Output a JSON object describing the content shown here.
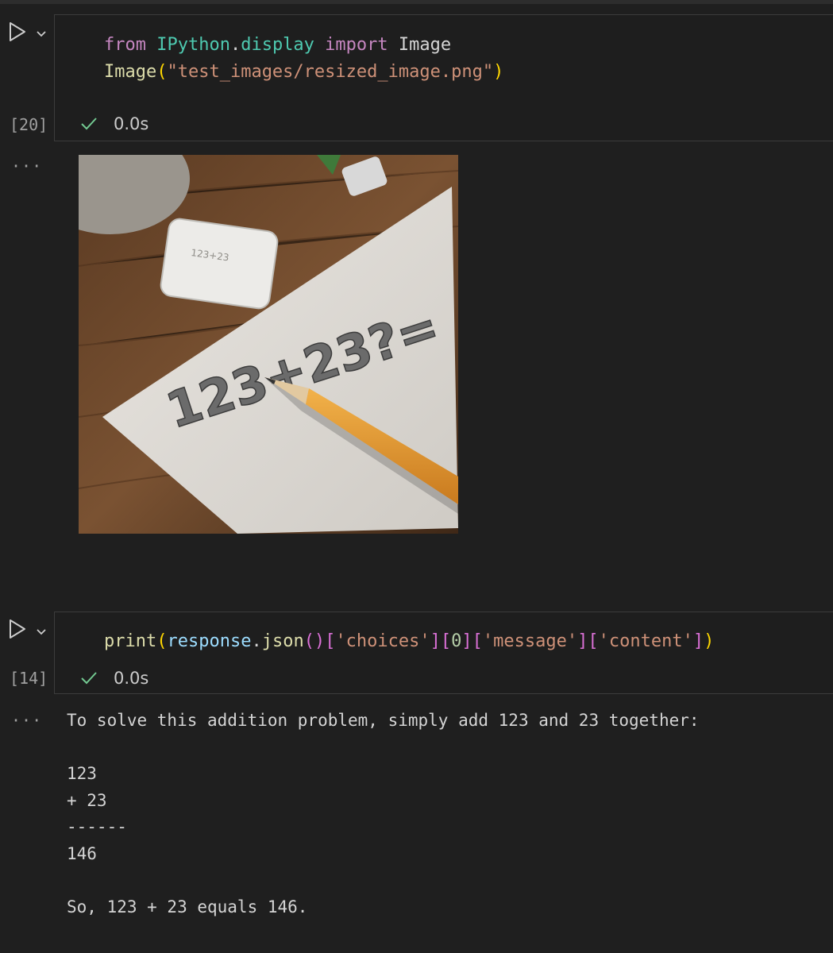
{
  "cells": [
    {
      "execution_count": "[20]",
      "code_lines": [
        [
          {
            "t": "from",
            "c": "kw"
          },
          {
            "t": " "
          },
          {
            "t": "IPython",
            "c": "mod"
          },
          {
            "t": "."
          },
          {
            "t": "display",
            "c": "mod"
          },
          {
            "t": " "
          },
          {
            "t": "import",
            "c": "kw"
          },
          {
            "t": " Image"
          }
        ],
        [
          {
            "t": "Image",
            "c": "fn"
          },
          {
            "t": "(",
            "c": "b1"
          },
          {
            "t": "\"test_images/resized_image.png\"",
            "c": "str"
          },
          {
            "t": ")",
            "c": "b1"
          }
        ]
      ],
      "status_time": "0.0s",
      "output": {
        "type": "image",
        "image_text": "123+23?=",
        "eraser_text": "123+23"
      }
    },
    {
      "execution_count": "[14]",
      "code_lines": [
        [
          {
            "t": "print",
            "c": "fn"
          },
          {
            "t": "(",
            "c": "b1"
          },
          {
            "t": "response",
            "c": "var"
          },
          {
            "t": "."
          },
          {
            "t": "json",
            "c": "fn"
          },
          {
            "t": "()",
            "c": "b2"
          },
          {
            "t": "[",
            "c": "b2"
          },
          {
            "t": "'choices'",
            "c": "str"
          },
          {
            "t": "]",
            "c": "b2"
          },
          {
            "t": "[",
            "c": "b2"
          },
          {
            "t": "0",
            "c": "num"
          },
          {
            "t": "]",
            "c": "b2"
          },
          {
            "t": "[",
            "c": "b2"
          },
          {
            "t": "'message'",
            "c": "str"
          },
          {
            "t": "]",
            "c": "b2"
          },
          {
            "t": "[",
            "c": "b2"
          },
          {
            "t": "'content'",
            "c": "str"
          },
          {
            "t": "]",
            "c": "b2"
          },
          {
            "t": ")",
            "c": "b1"
          }
        ]
      ],
      "status_time": "0.0s",
      "output": {
        "type": "text",
        "text": "To solve this addition problem, simply add 123 and 23 together:\n\n123\n+ 23\n------\n146\n\nSo, 123 + 23 equals 146."
      }
    }
  ],
  "icons": {
    "run": "play-icon",
    "expand": "chevron-down-icon",
    "success": "check-icon",
    "more": "ellipsis-icon"
  },
  "colors": {
    "background": "#1f1f1f",
    "cell_border": "#3c3c3c",
    "success_check": "#73c991",
    "keyword": "#c586c0",
    "module": "#4ec9b0",
    "function": "#dcdcaa",
    "string": "#ce9178"
  }
}
